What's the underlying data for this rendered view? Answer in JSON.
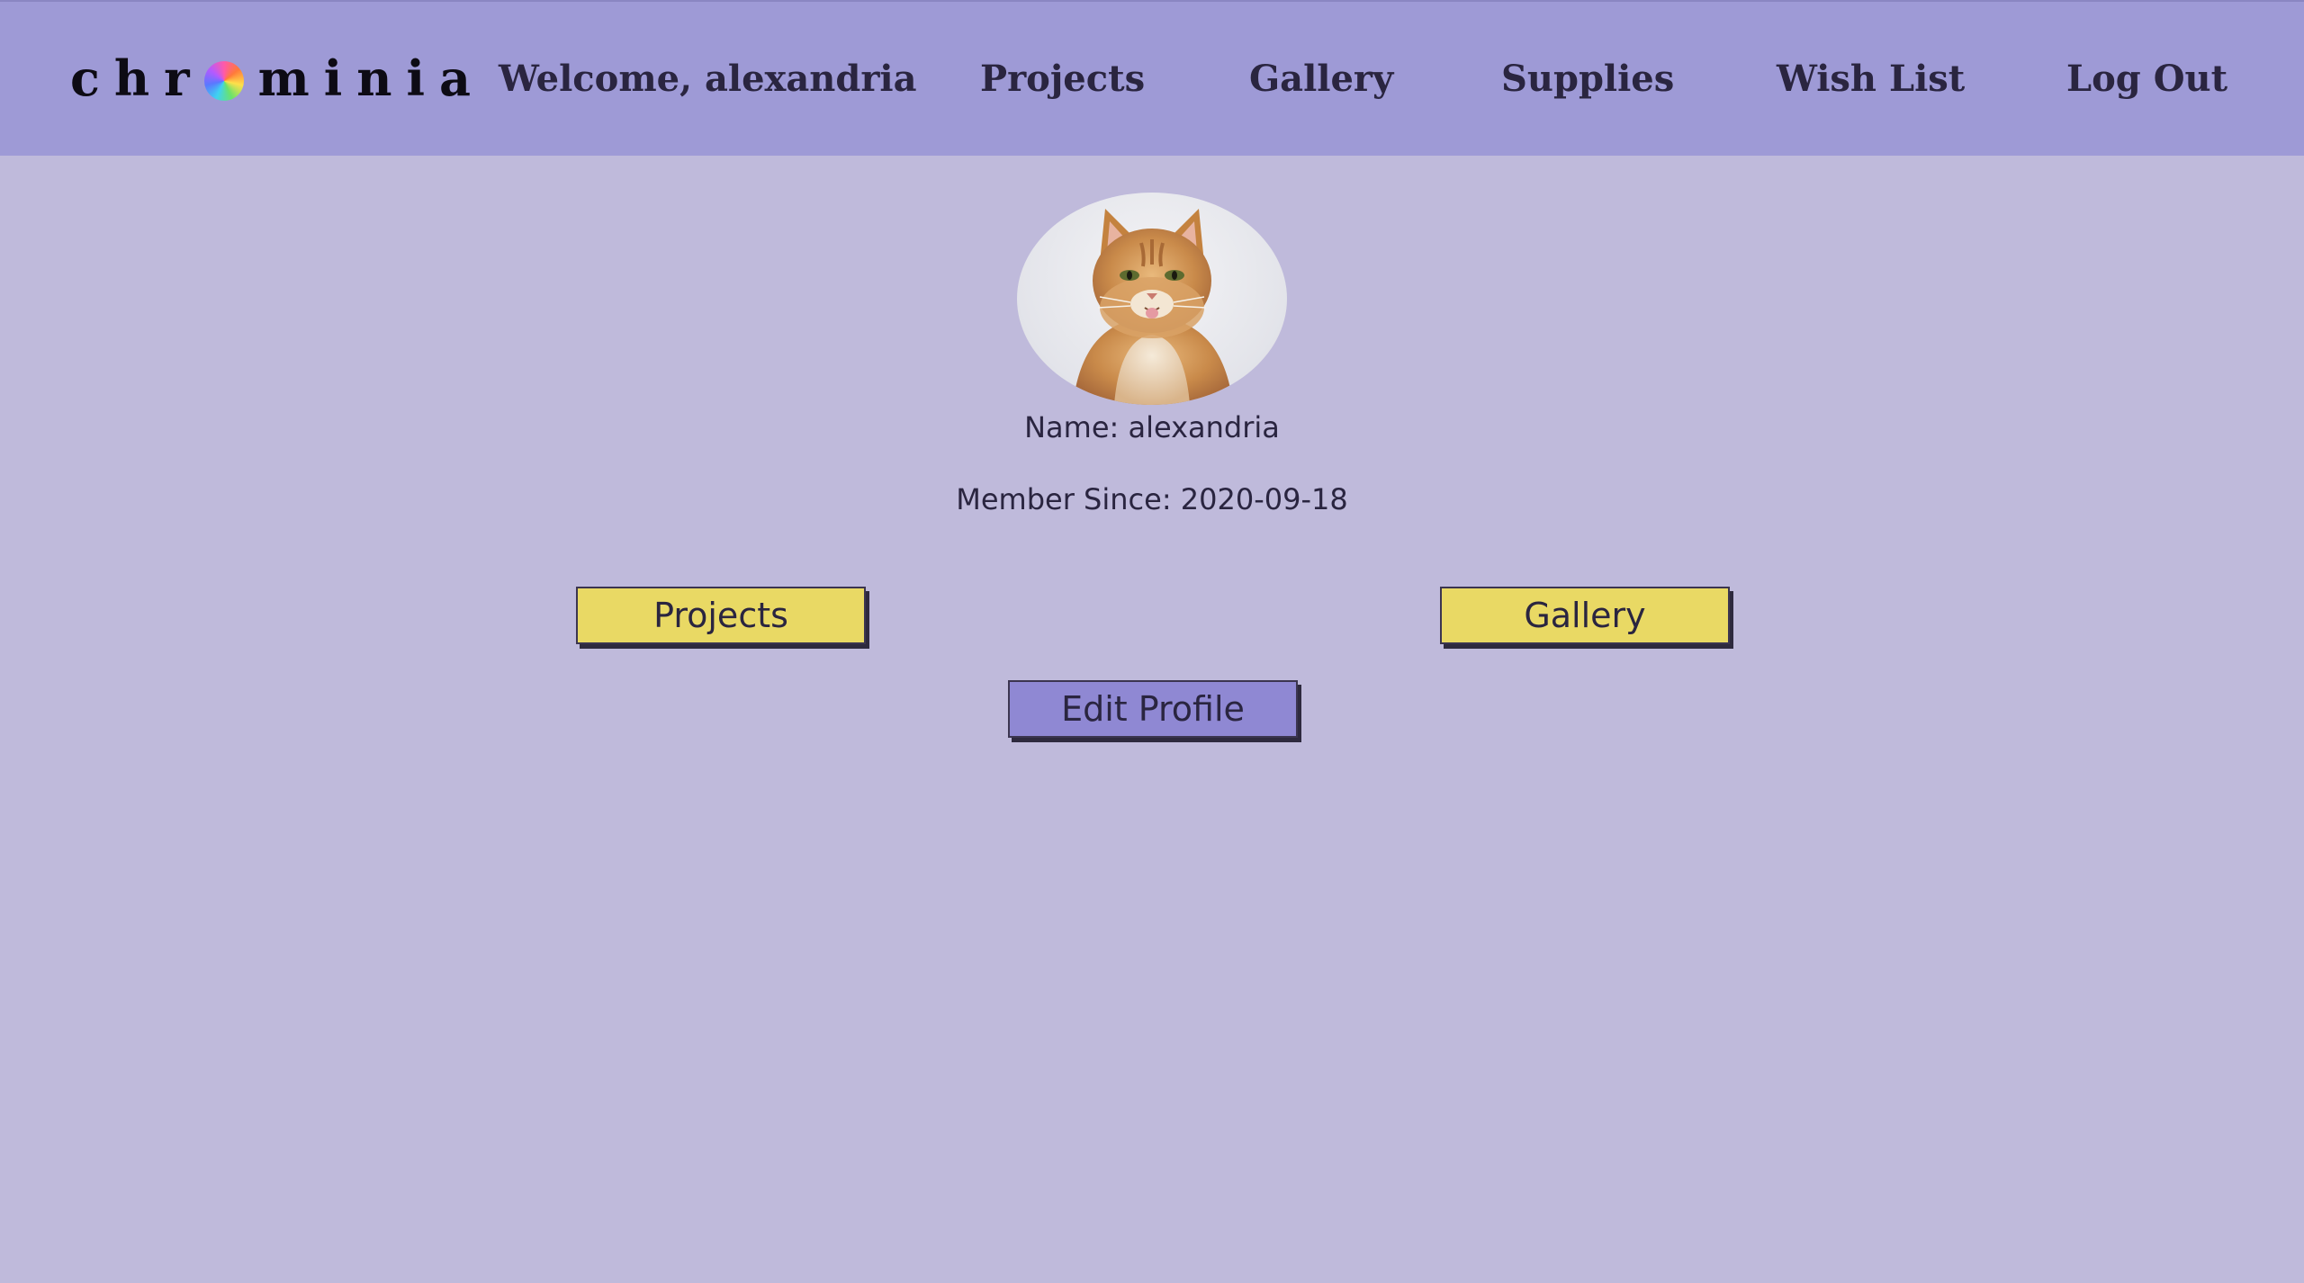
{
  "header": {
    "logo_prefix": "chr",
    "logo_suffix": "minia",
    "welcome": "Welcome, alexandria",
    "nav": {
      "projects": "Projects",
      "gallery": "Gallery",
      "supplies": "Supplies",
      "wish_list": "Wish List",
      "log_out": "Log Out"
    }
  },
  "profile": {
    "name_line": "Name: alexandria",
    "member_line": "Member Since: 2020-09-18",
    "avatar_subject": "orange tabby cat"
  },
  "actions": {
    "projects": "Projects",
    "gallery": "Gallery",
    "edit_profile": "Edit Profile"
  },
  "colors": {
    "navbar": "#9e9ad6",
    "background": "#bfbadb",
    "primary_button": "#e9d964",
    "secondary_button": "#8f88d3"
  },
  "icons": {
    "logo_wheel": "color-wheel-icon"
  }
}
